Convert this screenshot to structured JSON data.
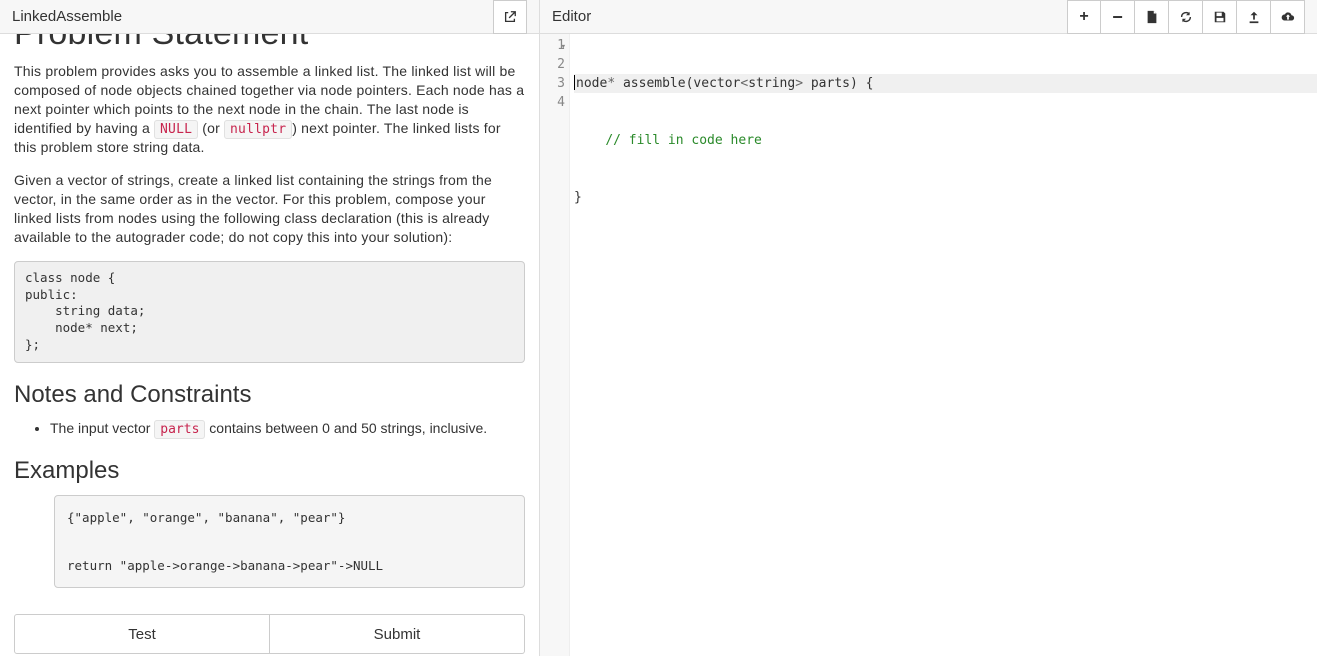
{
  "left": {
    "title": "LinkedAssemble",
    "open_icon": "external-link-icon",
    "h1": "Problem Statement",
    "para1_before": "This problem provides asks you to assemble a linked list.  The linked list will be composed of node objects chained together via node pointers. Each node has a next pointer which points to the next node in the chain. The last node is identified by having a ",
    "null_code": "NULL",
    "para1_mid": " (or ",
    "nullptr_code": "nullptr",
    "para1_after": ") next pointer.  The linked lists for this problem store string data.",
    "para2": "Given a vector of strings, create a linked list containing the strings from the vector, in the same order as in the vector.  For this problem, compose your linked lists from nodes using the following class declaration (this is already available to the autograder code; do not copy this into your solution):",
    "classdecl": "class node {\npublic:\n    string data;\n    node* next;\n};",
    "notes_h": "Notes and Constraints",
    "note_before": "The input vector ",
    "note_code": "parts",
    "note_after": " contains between 0 and 50 strings, inclusive.",
    "examples_h": "Examples",
    "example_block": "{\"apple\", \"orange\", \"banana\", \"pear\"}\n\nreturn \"apple->orange->banana->pear\"->NULL",
    "test_btn": "Test",
    "submit_btn": "Submit"
  },
  "right": {
    "title": "Editor",
    "toolbar": {
      "zoom_in": "+",
      "zoom_out": "−",
      "new_file": "new-file",
      "refresh": "refresh",
      "save": "save",
      "upload": "upload",
      "cloud_upload": "cloud-upload"
    },
    "gutter": [
      "1",
      "2",
      "3",
      "4"
    ],
    "code": {
      "l1": {
        "t_node": "node",
        "t_star": "*",
        "t_sp1": " ",
        "t_assemble": "assemble",
        "t_lp": "(",
        "t_vector": "vector",
        "t_lt": "<",
        "t_string": "string",
        "t_gt": ">",
        "t_sp2": " ",
        "t_parts": "parts",
        "t_rp": ")",
        "t_sp3": " ",
        "t_lbrace": "{"
      },
      "l2": {
        "indent": "    ",
        "comment": "// fill in code here"
      },
      "l3": {
        "rbrace": "}"
      },
      "l4": {
        "empty": ""
      }
    }
  }
}
